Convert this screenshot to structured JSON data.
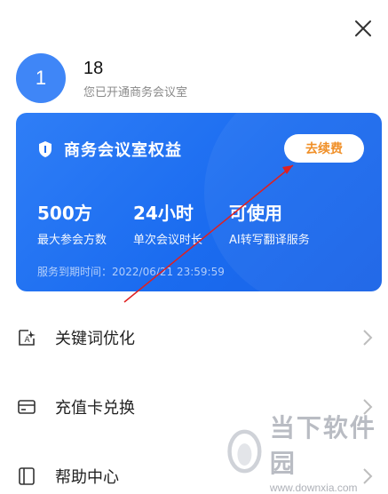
{
  "header": {
    "close_icon": "close-icon"
  },
  "profile": {
    "avatar_text": "1",
    "username": "18",
    "status": "您已开通商务会议室"
  },
  "card": {
    "icon": "shield-icon",
    "title": "商务会议室权益",
    "renew_label": "去续费",
    "benefits": [
      {
        "value": "500方",
        "label": "最大参会方数"
      },
      {
        "value": "24小时",
        "label": "单次会议时长"
      },
      {
        "value": "可使用",
        "label": "AI转写翻译服务"
      }
    ],
    "expiry": "服务到期时间：2022/06/21 23:59:59",
    "colors": {
      "background": "#1b6cf0",
      "renew_text": "#f08a1c"
    }
  },
  "annotation": {
    "color": "#e02020"
  },
  "menu": [
    {
      "icon": "ai-text-icon",
      "label": "关键词优化"
    },
    {
      "icon": "card-icon",
      "label": "充值卡兑换"
    },
    {
      "icon": "book-icon",
      "label": "帮助中心"
    }
  ],
  "watermark": {
    "title": "当下软件园",
    "url": "www.downxia.com"
  }
}
